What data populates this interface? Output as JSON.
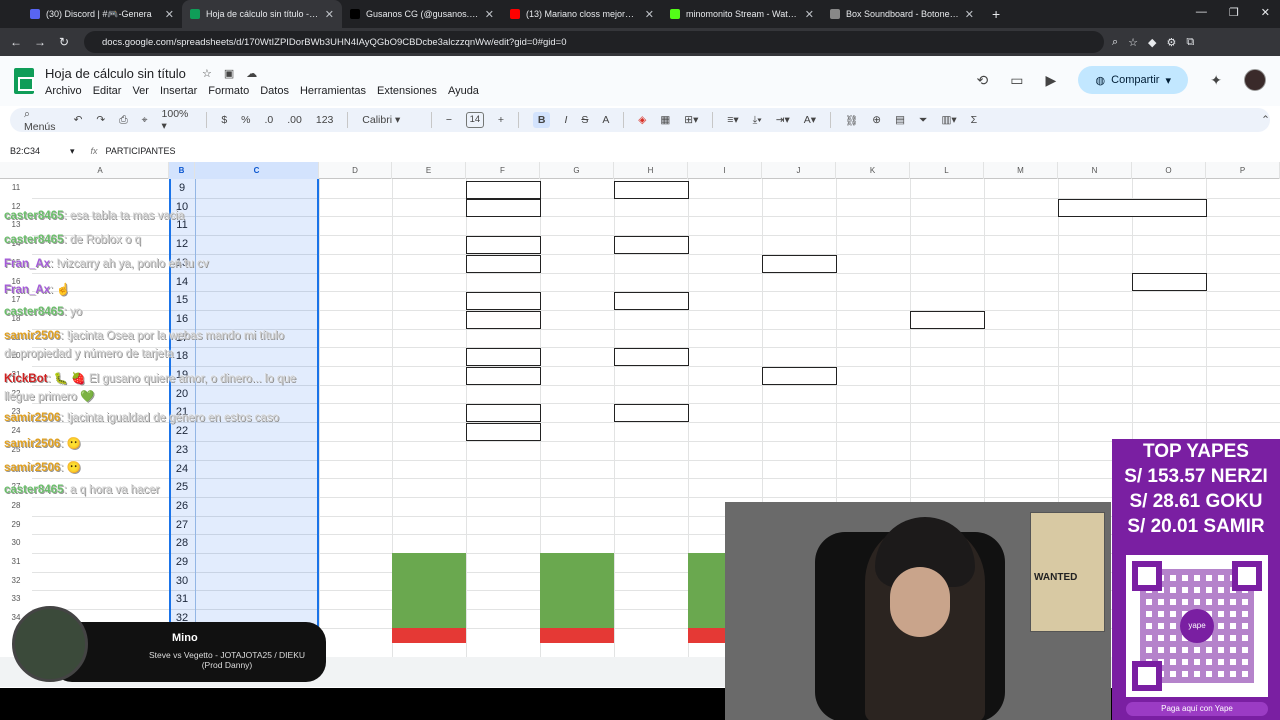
{
  "browser": {
    "tabs": [
      {
        "label": "(30) Discord | #🎮-Genera",
        "color": "#5865f2"
      },
      {
        "label": "Hoja de cálculo sin título - Hoja",
        "color": "#0f9d58"
      },
      {
        "label": "Gusanos CG (@gusanos.cg) | Ti",
        "color": "#000000"
      },
      {
        "label": "(13) Mariano closs mejores rela",
        "color": "#ff0000"
      },
      {
        "label": "minomonito Stream - Watch Li",
        "color": "#53fc18"
      },
      {
        "label": "Box Soundboard - Botones de",
        "color": "#888888"
      }
    ],
    "url": "docs.google.com/spreadsheets/d/170WtIZPIDorBWb3UHN4IAyQGbO9CBDcbe3alczzqnWw/edit?gid=0#gid=0"
  },
  "sheets": {
    "title": "Hoja de cálculo sin título",
    "menus": [
      "Archivo",
      "Editar",
      "Ver",
      "Insertar",
      "Formato",
      "Datos",
      "Herramientas",
      "Extensiones",
      "Ayuda"
    ],
    "share_label": "Compartir",
    "toolbar": {
      "menus_label": "Menús",
      "zoom": "100%",
      "currency": "$",
      "percent": "%",
      "dec_less": ".0",
      "dec_more": ".00",
      "format_123": "123",
      "font": "Calibri",
      "font_size": "14",
      "bold": "B",
      "italic": "I",
      "strike": "S",
      "text_color": "A"
    },
    "namebox": "B2:C34",
    "formula": "PARTICIPANTES",
    "columns": [
      "A",
      "B",
      "C",
      "D",
      "E",
      "F",
      "G",
      "H",
      "I",
      "J",
      "K",
      "L",
      "M",
      "N",
      "O",
      "P"
    ],
    "row_numbers": [
      "11",
      "12",
      "13",
      "14",
      "15",
      "16",
      "17",
      "18",
      "19",
      "20",
      "21",
      "22",
      "23",
      "24",
      "25",
      "26",
      "27",
      "28",
      "29",
      "30",
      "31",
      "32",
      "33",
      "34"
    ],
    "column_b_values": [
      "9",
      "10",
      "11",
      "12",
      "13",
      "14",
      "15",
      "16",
      "17",
      "18",
      "19",
      "20",
      "21",
      "22",
      "23",
      "24",
      "25",
      "26",
      "27",
      "28",
      "29",
      "30",
      "31",
      "32"
    ]
  },
  "chat": [
    {
      "user": "caster8465",
      "message": ": esa tabla ta mas vacia",
      "color": "#6abe6a"
    },
    {
      "user": "caster8465",
      "message": ": de Roblox o q",
      "color": "#6abe6a"
    },
    {
      "user": "Fran_Ax",
      "message": ": !vizcarry ah ya, ponlo en tu cv",
      "color": "#a45bd8"
    },
    {
      "user": "Fran_Ax",
      "message": ": ☝",
      "color": "#a45bd8"
    },
    {
      "user": "caster8465",
      "message": ": yo",
      "color": "#6abe6a"
    },
    {
      "user": "samir2506",
      "message": ": !jacinta Osea por la webas mando mi título",
      "color": "#e0a020"
    },
    {
      "user": "",
      "message": "de propiedad y número de tarjeta",
      "color": "#e0a020"
    },
    {
      "user": "KickBot",
      "message": ": 🐛 🍓 El gusano quiere amor, o dinero... lo que",
      "color": "#d02020"
    },
    {
      "user": "",
      "message": "llegue primero 💚",
      "color": "#d02020"
    },
    {
      "user": "samir2506",
      "message": ": !jacinta igualdad de género en estos caso",
      "color": "#e0a020"
    },
    {
      "user": "samir2506",
      "message": ": 😶",
      "color": "#e0a020"
    },
    {
      "user": "samir2506",
      "message": ": 😶",
      "color": "#e0a020"
    },
    {
      "user": "caster8465",
      "message": ": a q hora va hacer",
      "color": "#6abe6a"
    }
  ],
  "music": {
    "artist": "Mino",
    "title": "Steve vs Vegetto - JOTAJOTA25 / DIEKU (Prod Danny)"
  },
  "webcam": {
    "poster_text": "WANTED"
  },
  "yapes": {
    "lines": [
      "TOP YAPES",
      "S/ 153.57 NERZI",
      "S/ 28.61 GOKU",
      "S/ 20.01 SAMIR"
    ],
    "qr_logo": "yape",
    "cta": "Paga aquí con Yape"
  }
}
